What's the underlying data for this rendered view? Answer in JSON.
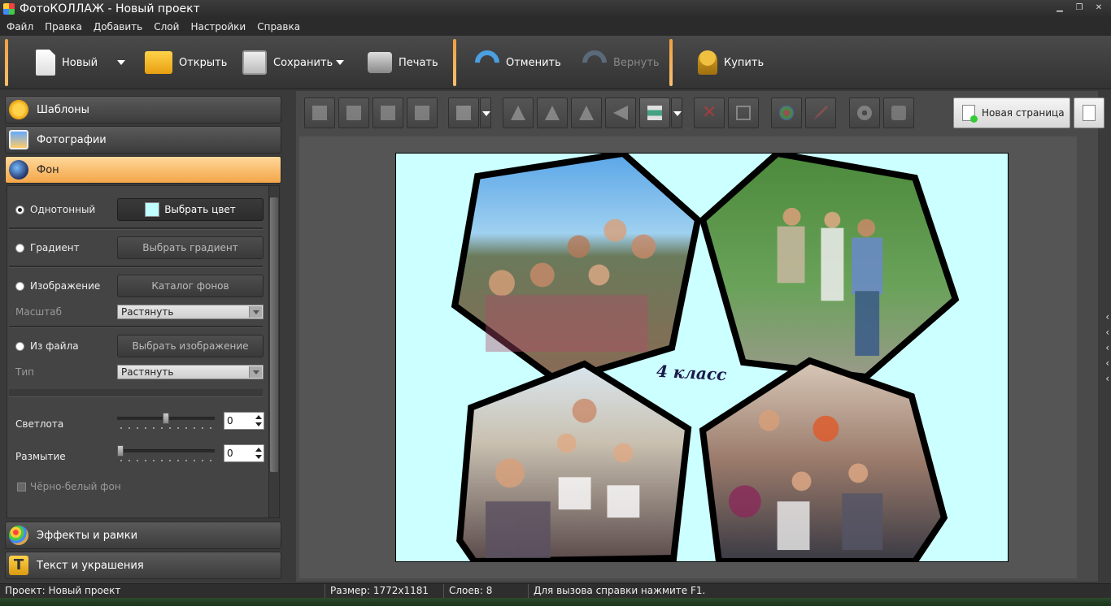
{
  "window": {
    "title": "ФотоКОЛЛАЖ - Новый проект"
  },
  "menu": [
    "Файл",
    "Правка",
    "Добавить",
    "Слой",
    "Настройки",
    "Справка"
  ],
  "toolbar": {
    "new_label": "Новый",
    "open_label": "Открыть",
    "save_label": "Сохранить",
    "print_label": "Печать",
    "undo_label": "Отменить",
    "redo_label": "Вернуть",
    "buy_label": "Купить"
  },
  "sidebar": {
    "sections": [
      {
        "label": "Шаблоны",
        "icon": "star-icon"
      },
      {
        "label": "Фотографии",
        "icon": "photos-icon"
      },
      {
        "label": "Фон",
        "icon": "background-icon"
      },
      {
        "label": "Эффекты и рамки",
        "icon": "palette-icon"
      },
      {
        "label": "Текст и украшения",
        "icon": "text-icon"
      }
    ],
    "background": {
      "solid_label": "Однотонный",
      "choose_color_label": "Выбрать цвет",
      "selected_color": "#bfffff",
      "gradient_label": "Градиент",
      "choose_gradient_label": "Выбрать градиент",
      "image_label": "Изображение",
      "catalog_label": "Каталог фонов",
      "scale_label": "Масштаб",
      "scale_value": "Растянуть",
      "from_file_label": "Из файла",
      "choose_image_label": "Выбрать изображение",
      "type_label": "Тип",
      "type_value": "Растянуть",
      "brightness_label": "Светлота",
      "brightness_value": "0",
      "blur_label": "Размытие",
      "blur_value": "0",
      "bw_label": "Чёрно-белый фон"
    }
  },
  "editor": {
    "new_page_label": "Новая страница",
    "caption_text": "4 класс",
    "background_color": "#ccffff"
  },
  "status": {
    "project": "Проект:  Новый проект",
    "size": "Размер:  1772x1181",
    "layers": "Слоев:  8",
    "hint": "Для вызова справки нажмите F1."
  }
}
